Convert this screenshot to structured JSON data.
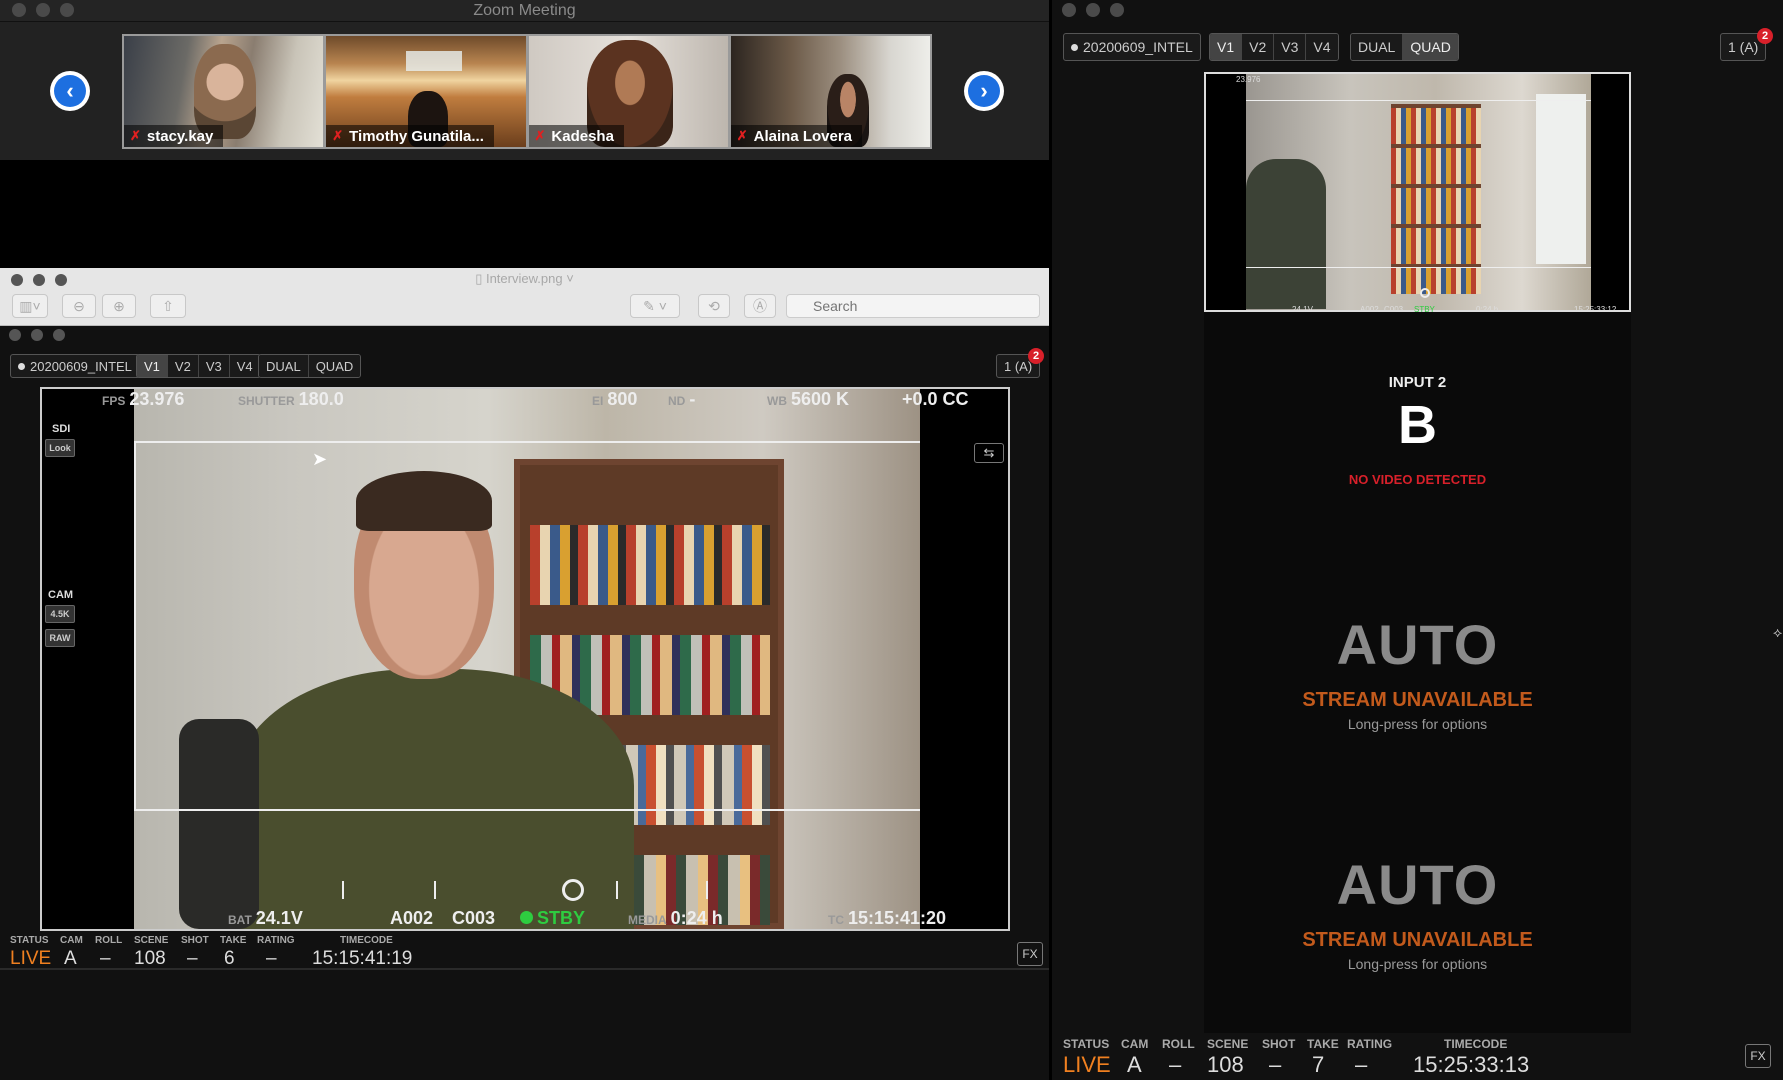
{
  "zoom": {
    "title": "Zoom Meeting",
    "participants": [
      {
        "name": "stacy.kay"
      },
      {
        "name": "Timothy Gunatila..."
      },
      {
        "name": "Kadesha"
      },
      {
        "name": "Alaina Lovera"
      }
    ],
    "prev_icon": "chevron-left-icon",
    "next_icon": "chevron-right-icon"
  },
  "preview": {
    "title": "Interview.png",
    "search_placeholder": "Search"
  },
  "monitor_left": {
    "project": "20200609_INTEL",
    "views": [
      "V1",
      "V2",
      "V3",
      "V4"
    ],
    "active_view": "V1",
    "layouts": [
      "DUAL",
      "QUAD"
    ],
    "source": "1 (A)",
    "badge": "2",
    "overlay": {
      "fps_label": "FPS",
      "fps": "23.976",
      "shutter_label": "SHUTTER",
      "shutter": "180.0",
      "ei_label": "EI",
      "ei": "800",
      "nd_label": "ND",
      "nd": "-",
      "wb_label": "WB",
      "wb": "5600 K",
      "cc": "+0.0 CC",
      "bat_label": "BAT",
      "bat": "24.1V",
      "reel": "A002",
      "clip": "C003",
      "rec_state": "STBY",
      "media_label": "MEDIA",
      "media": "0:24 h",
      "tc_label": "TC",
      "tc": "15:15:41:20",
      "sdi": "SDI",
      "look": "Look",
      "cam": "CAM",
      "res": "4.5K",
      "codec": "RAW"
    },
    "status": {
      "labels": [
        "STATUS",
        "CAM",
        "ROLL",
        "SCENE",
        "SHOT",
        "TAKE",
        "RATING",
        "TIMECODE"
      ],
      "status": "LIVE",
      "cam": "A",
      "roll": "–",
      "scene": "108",
      "shot": "–",
      "take": "6",
      "rating": "–",
      "timecode": "15:15:41:19"
    },
    "fx": "FX"
  },
  "monitor_right": {
    "project": "20200609_INTEL",
    "views": [
      "V1",
      "V2",
      "V3",
      "V4"
    ],
    "active_view": "V1",
    "layouts": [
      "DUAL",
      "QUAD"
    ],
    "active_layout": "QUAD",
    "source": "1 (A)",
    "badge": "2",
    "thumb": {
      "fps": "23.976",
      "bat": "24.1V",
      "reel": "A002",
      "clip": "C003",
      "rec": "STBY",
      "media": "0:24 h",
      "tc": "15:25:33:12"
    },
    "input2": {
      "label": "INPUT 2",
      "letter": "B",
      "msg": "NO VIDEO DETECTED"
    },
    "slots": [
      {
        "title": "AUTO",
        "msg": "STREAM UNAVAILABLE",
        "hint": "Long-press for options"
      },
      {
        "title": "AUTO",
        "msg": "STREAM UNAVAILABLE",
        "hint": "Long-press for options"
      }
    ],
    "status": {
      "labels": [
        "STATUS",
        "CAM",
        "ROLL",
        "SCENE",
        "SHOT",
        "TAKE",
        "RATING",
        "TIMECODE"
      ],
      "status": "LIVE",
      "cam": "A",
      "roll": "–",
      "scene": "108",
      "shot": "–",
      "take": "7",
      "rating": "–",
      "timecode": "15:25:33:13"
    },
    "fx": "FX"
  },
  "colors": {
    "live": "#f08020",
    "stby": "#2ecc40",
    "no_video": "#d8202a",
    "unavailable": "#c25a1c",
    "zoom_blue": "#1d6fe0"
  }
}
